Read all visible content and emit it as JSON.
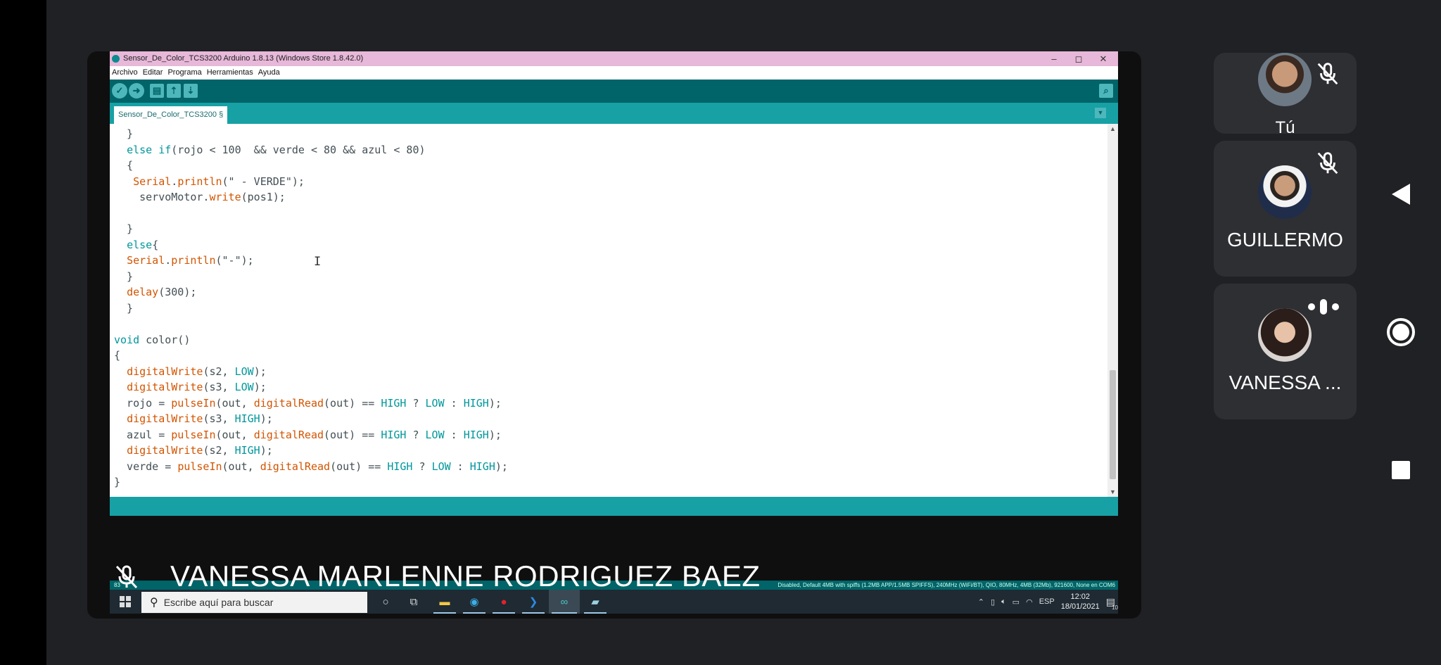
{
  "ide": {
    "title": "Sensor_De_Color_TCS3200 Arduino 1.8.13 (Windows Store 1.8.42.0)",
    "window_controls": [
      "–",
      "◻",
      "✕"
    ],
    "menu": [
      "Archivo",
      "Editar",
      "Programa",
      "Herramientas",
      "Ayuda"
    ],
    "toolbar_icons": [
      "verify-icon",
      "upload-icon",
      "new-icon",
      "open-icon",
      "save-icon",
      "serial-monitor-icon"
    ],
    "tab_label": "Sensor_De_Color_TCS3200 §",
    "code_lines": [
      "  }",
      "  else if(rojo < 100  && verde < 80 && azul < 80)",
      "  {",
      "   Serial.println(\" - VERDE\");",
      "    servoMotor.write(pos1);",
      "",
      "  }",
      "  else{",
      "  Serial.println(\"-\");",
      "  }",
      "  delay(300);",
      "  }",
      "",
      "void color()",
      "{",
      "  digitalWrite(s2, LOW);",
      "  digitalWrite(s3, LOW);",
      "  rojo = pulseIn(out, digitalRead(out) == HIGH ? LOW : HIGH);",
      "  digitalWrite(s3, HIGH);",
      "  azul = pulseIn(out, digitalRead(out) == HIGH ? LOW : HIGH);",
      "  digitalWrite(s2, HIGH);",
      "  verde = pulseIn(out, digitalRead(out) == HIGH ? LOW : HIGH);",
      "}"
    ],
    "status_line_number": "83",
    "status_board": "Disabled, Default 4MB with spiffs (1.2MB APP/1.5MB SPIFFS), 240MHz (WiFi/BT), QIO, 80MHz, 4MB (32Mb), 921600, None en COM6"
  },
  "taskbar": {
    "search_placeholder": "Escribe aquí para buscar",
    "lang": "ESP",
    "time": "12:02",
    "date": "18/01/2021",
    "notifications": "10"
  },
  "presenter_name": "VANESSA MARLENNE RODRIGUEZ BAEZ",
  "participants": [
    {
      "name": "Tú",
      "muted": true
    },
    {
      "name": "GUILLERMO",
      "muted": true
    },
    {
      "name": "VANESSA ...",
      "speaking": true
    }
  ],
  "colors": {
    "arduino_teal_dark": "#006468",
    "arduino_teal": "#17a1a5",
    "title_pink": "#e7b8d9",
    "meet_tile": "#2e2f33",
    "meet_bg": "#202124"
  }
}
